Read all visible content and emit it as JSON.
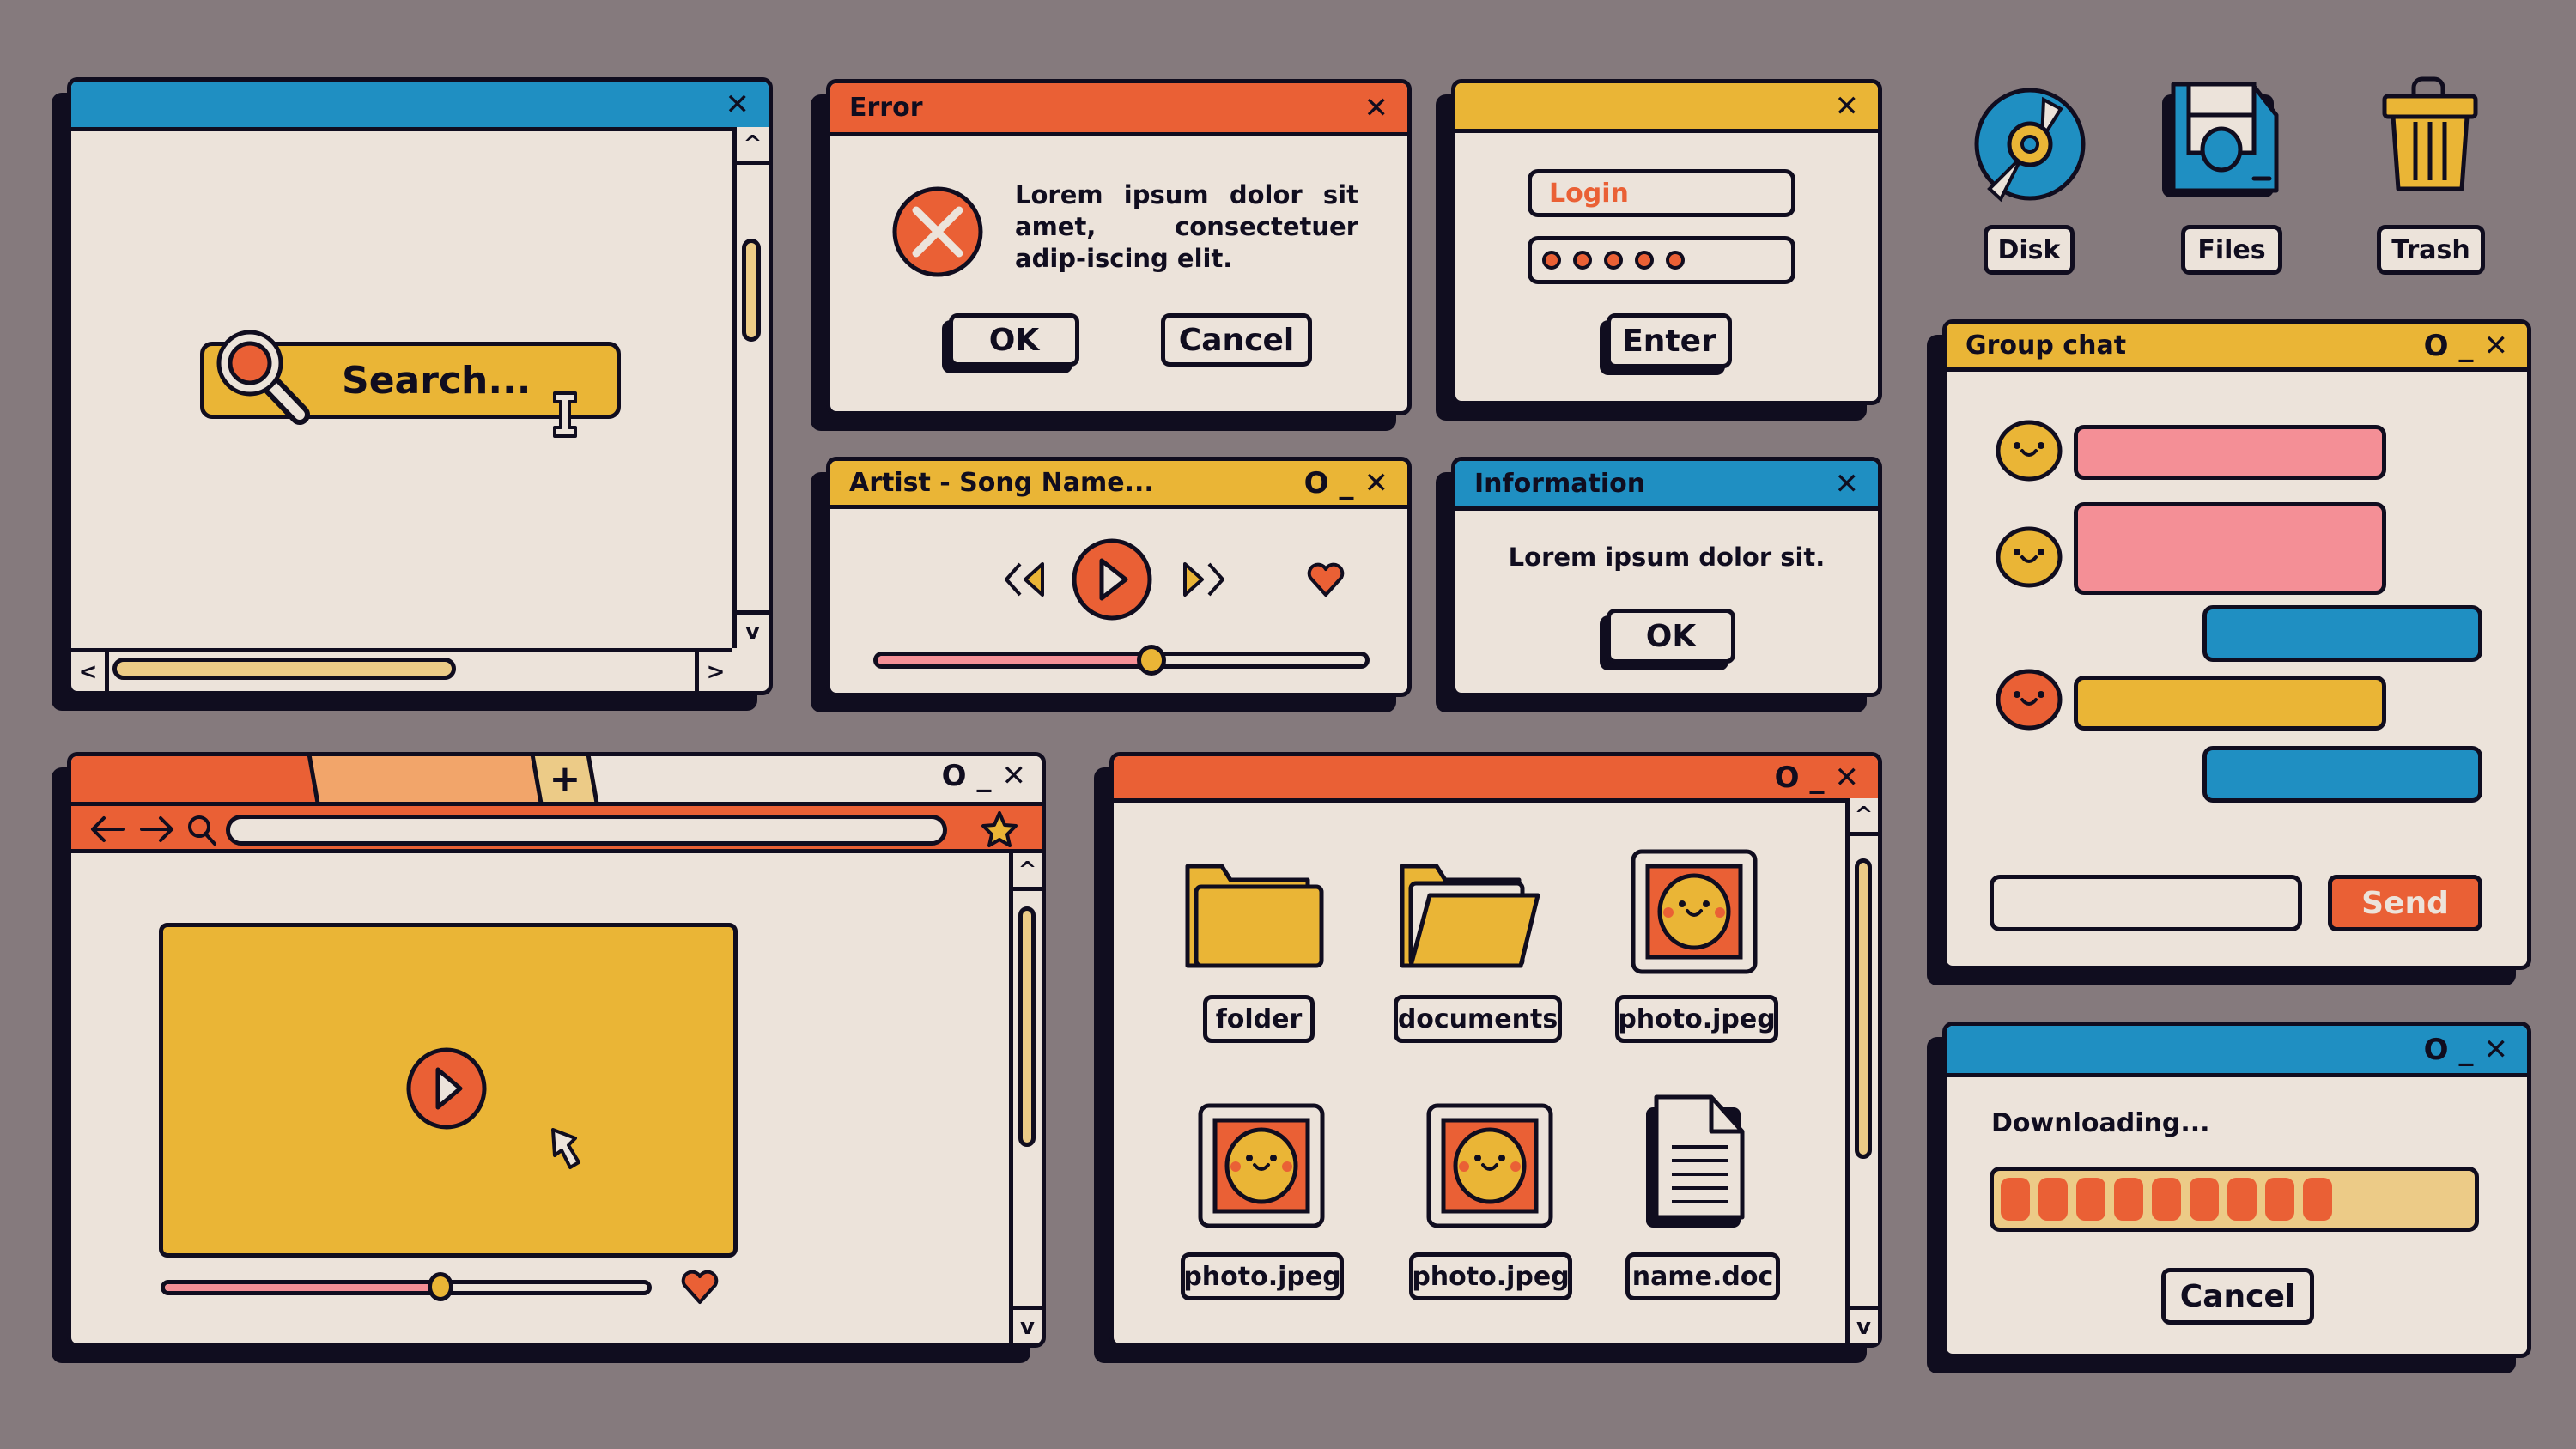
{
  "colors": {
    "background": "#857a7d",
    "outline": "#100d1f",
    "paper": "#ece3da",
    "blue": "#1f8fc2",
    "orange": "#ea6035",
    "yellow": "#eab536",
    "pink": "#f48f96",
    "sand": "#eccb87",
    "peach": "#f2a56a"
  },
  "controls": {
    "close": "✕",
    "minimize": "_",
    "maximize": "O"
  },
  "search_window": {
    "title": "",
    "search_placeholder": "Search...",
    "icons": [
      "magnifier-icon",
      "text-cursor-icon"
    ],
    "scroll": {
      "up": "^",
      "down": "v",
      "left": "<",
      "right": ">"
    }
  },
  "error_dialog": {
    "title": "Error",
    "message": "Lorem ipsum dolor sit amet, consectetuer adip-iscing elit.",
    "ok": "OK",
    "cancel": "Cancel"
  },
  "login_dialog": {
    "title": "",
    "login_placeholder": "Login",
    "password_mask_count": 5,
    "enter": "Enter"
  },
  "desktop_icons": [
    {
      "label": "Disk",
      "icon": "disc-icon"
    },
    {
      "label": "Files",
      "icon": "floppy-icon"
    },
    {
      "label": "Trash",
      "icon": "trash-icon"
    }
  ],
  "music_player": {
    "title": "Artist - Song Name...",
    "progress": 0.56,
    "icons": [
      "rewind-icon",
      "play-icon",
      "fast-forward-icon",
      "heart-icon"
    ]
  },
  "info_dialog": {
    "title": "Information",
    "message": "Lorem ipsum dolor sit.",
    "ok": "OK"
  },
  "group_chat": {
    "title": "Group chat",
    "messages": [
      {
        "side": "left",
        "avatar": "yellow"
      },
      {
        "side": "left",
        "avatar": "yellow"
      },
      {
        "side": "right"
      },
      {
        "side": "left",
        "avatar": "orange"
      },
      {
        "side": "right"
      }
    ],
    "input_value": "",
    "send": "Send"
  },
  "browser": {
    "tabs": [
      "",
      "",
      ""
    ],
    "new_tab": "+",
    "url": "",
    "video_progress": 0.57,
    "icons": [
      "back-arrow-icon",
      "forward-arrow-icon",
      "search-icon",
      "star-icon",
      "play-icon",
      "cursor-icon",
      "heart-icon"
    ]
  },
  "file_explorer": {
    "title": "",
    "items": [
      {
        "label": "folder",
        "icon": "folder-icon"
      },
      {
        "label": "documents",
        "icon": "open-folder-icon"
      },
      {
        "label": "photo.jpeg",
        "icon": "photo-icon"
      },
      {
        "label": "photo.jpeg",
        "icon": "photo-icon"
      },
      {
        "label": "photo.jpeg",
        "icon": "photo-icon"
      },
      {
        "label": "name.doc",
        "icon": "document-icon"
      }
    ]
  },
  "download_dialog": {
    "title": "",
    "status": "Downloading...",
    "progress_segments_filled": 9,
    "progress": 0.65,
    "cancel": "Cancel"
  }
}
